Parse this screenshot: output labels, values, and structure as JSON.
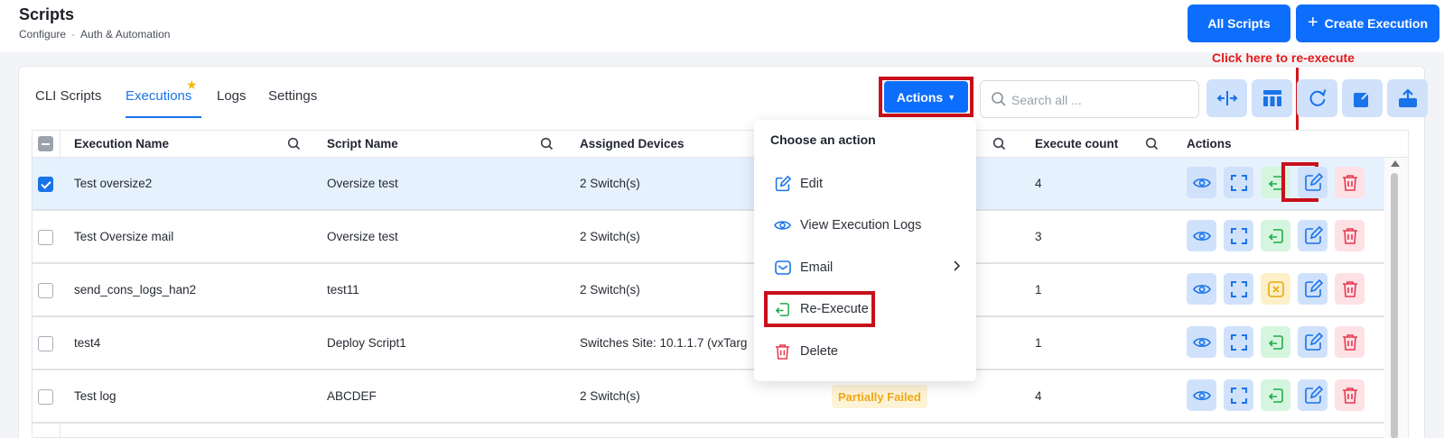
{
  "header": {
    "title": "Scripts",
    "breadcrumb": [
      "Configure",
      "Auth & Automation"
    ],
    "breadcrumb_sep": "-",
    "all_scripts_label": "All Scripts",
    "create_execution_label": "Create Execution"
  },
  "tabs": [
    {
      "label": "CLI Scripts",
      "active": false
    },
    {
      "label": "Executions",
      "active": true
    },
    {
      "label": "Logs",
      "active": false
    },
    {
      "label": "Settings",
      "active": false
    }
  ],
  "toolbar": {
    "actions_label": "Actions",
    "search_placeholder": "Search all ...",
    "tools": [
      "split-columns-icon",
      "column-layout-icon",
      "refresh-icon",
      "expand-icon",
      "upload-icon"
    ]
  },
  "annotation": {
    "text": "Click here to re-execute",
    "color": "#e51a1a"
  },
  "table": {
    "columns": [
      "Execution Name",
      "Script Name",
      "Assigned Devices",
      "Execute count",
      "Actions"
    ],
    "rows": [
      {
        "name": "Test oversize2",
        "script": "Oversize test",
        "devices": "2 Switch(s)",
        "status": "",
        "count": "4",
        "selected": true,
        "exec_icon": "re-execute"
      },
      {
        "name": "Test Oversize mail",
        "script": "Oversize test",
        "devices": "2 Switch(s)",
        "status": "",
        "count": "3",
        "selected": false,
        "exec_icon": "re-execute"
      },
      {
        "name": "send_cons_logs_han2",
        "script": "test11",
        "devices": "2 Switch(s)",
        "status": "",
        "count": "1",
        "selected": false,
        "exec_icon": "cancel"
      },
      {
        "name": "test4",
        "script": "Deploy Script1",
        "devices": "Switches Site: 10.1.1.7 (vxTarg",
        "status": "",
        "count": "1",
        "selected": false,
        "exec_icon": "re-execute"
      },
      {
        "name": "Test log",
        "script": "ABCDEF",
        "devices": "2 Switch(s)",
        "status": "Partially Failed",
        "count": "4",
        "selected": false,
        "exec_icon": "re-execute"
      }
    ]
  },
  "dropdown": {
    "title": "Choose an action",
    "items": [
      {
        "label": "Edit",
        "icon": "edit-icon"
      },
      {
        "label": "View Execution Logs",
        "icon": "eye-icon"
      },
      {
        "label": "Email",
        "icon": "mail-icon"
      },
      {
        "label": "Re-Execute",
        "icon": "re-execute-icon"
      },
      {
        "label": "Delete",
        "icon": "trash-icon"
      }
    ]
  },
  "colors": {
    "primary": "#0d6efd",
    "highlight_outline": "#c8101b",
    "status_warning": "#f0a818"
  }
}
